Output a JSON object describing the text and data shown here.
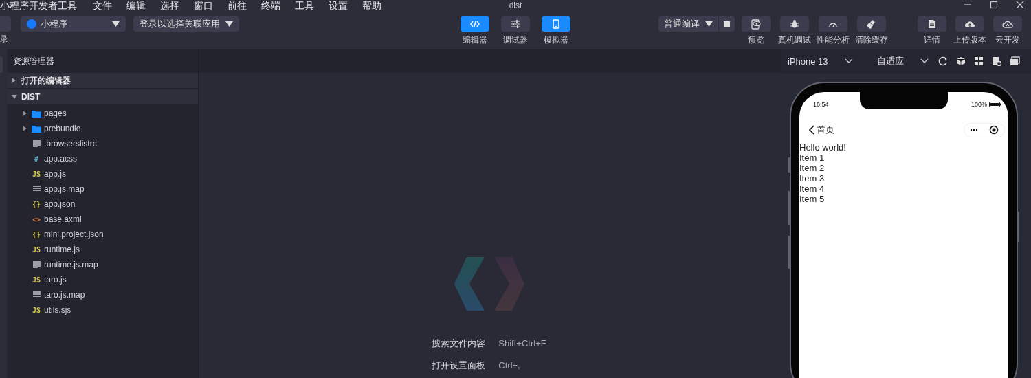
{
  "menubar": {
    "app_name": "小程序开发者工具",
    "menus": [
      "文件",
      "编辑",
      "选择",
      "窗口",
      "前往",
      "终端",
      "工具",
      "设置",
      "帮助"
    ],
    "title": "dist"
  },
  "toolbar": {
    "account_label": "录",
    "app_type": {
      "value": "小程序"
    },
    "linked_app": {
      "value": "登录以选择关联应用"
    },
    "views": [
      {
        "label": "编辑器",
        "kind": "code",
        "selected": true
      },
      {
        "label": "调试器",
        "kind": "sliders",
        "selected": false
      },
      {
        "label": "模拟器",
        "kind": "phone",
        "selected": true
      }
    ],
    "compile_mode": {
      "value": "普通编译"
    },
    "action_groups": [
      [
        {
          "label": "预览",
          "kind": "preview"
        },
        {
          "label": "真机调试",
          "kind": "bug"
        },
        {
          "label": "性能分析",
          "kind": "gauge"
        },
        {
          "label": "清除缓存",
          "kind": "brush"
        }
      ],
      [
        {
          "label": "详情",
          "kind": "document"
        },
        {
          "label": "上传版本",
          "kind": "upload"
        },
        {
          "label": "云开发",
          "kind": "cloud"
        }
      ]
    ]
  },
  "explorer": {
    "title": "资源管理器",
    "sections": [
      {
        "label": "打开的编辑器",
        "expanded": false
      },
      {
        "label": "DIST",
        "expanded": true,
        "children": [
          {
            "name": "pages",
            "kind": "folder",
            "expanded": false
          },
          {
            "name": "prebundle",
            "kind": "folder",
            "expanded": false
          },
          {
            "name": ".browserslistrc",
            "kind": "text"
          },
          {
            "name": "app.acss",
            "kind": "css",
            "glyph": "#"
          },
          {
            "name": "app.js",
            "kind": "js",
            "glyph": "JS"
          },
          {
            "name": "app.js.map",
            "kind": "text"
          },
          {
            "name": "app.json",
            "kind": "json",
            "glyph": "{}"
          },
          {
            "name": "base.axml",
            "kind": "xml",
            "glyph": "<>"
          },
          {
            "name": "mini.project.json",
            "kind": "json",
            "glyph": "{}"
          },
          {
            "name": "runtime.js",
            "kind": "js",
            "glyph": "JS"
          },
          {
            "name": "runtime.js.map",
            "kind": "text"
          },
          {
            "name": "taro.js",
            "kind": "js",
            "glyph": "JS"
          },
          {
            "name": "taro.js.map",
            "kind": "text"
          },
          {
            "name": "utils.sjs",
            "kind": "js",
            "glyph": "JS"
          }
        ]
      }
    ]
  },
  "editor": {
    "shortcuts": [
      {
        "label": "搜索文件内容",
        "keys": "Shift+Ctrl+F"
      },
      {
        "label": "打开设置面板",
        "keys": "Ctrl+,"
      }
    ]
  },
  "simulator": {
    "device": "iPhone 13",
    "scale": "自适应",
    "phone": {
      "time": "16:54",
      "battery": "100%",
      "nav_title": "首页",
      "content": [
        "Hello world!",
        "Item 1",
        "Item 2",
        "Item 3",
        "Item 4",
        "Item 5"
      ]
    }
  }
}
